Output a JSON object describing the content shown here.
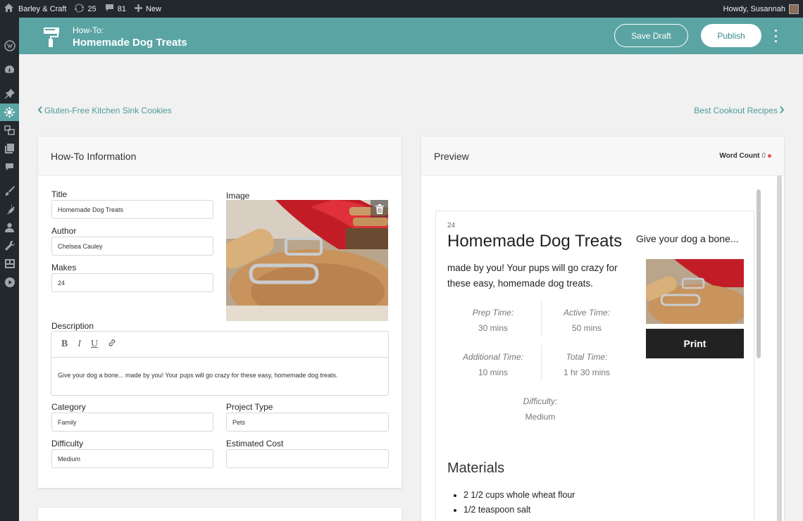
{
  "admin_bar": {
    "site_name": "Barley & Craft",
    "updates_count": "25",
    "comments_count": "81",
    "new_label": "New",
    "greeting": "Howdy, Susannah"
  },
  "header": {
    "kicker": "How-To:",
    "title": "Homemade Dog Treats",
    "save_draft_label": "Save Draft",
    "publish_label": "Publish"
  },
  "nav": {
    "prev_label": "Gluten-Free Kitchen Sink Cookies",
    "next_label": "Best Cookout Recipes"
  },
  "form": {
    "panel_title": "How-To Information",
    "title_label": "Title",
    "title_value": "Homemade Dog Treats",
    "author_label": "Author",
    "author_value": "Chelsea Cauley",
    "makes_label": "Makes",
    "makes_value": "24",
    "image_label": "Image",
    "description_label": "Description",
    "description_value": "Give your dog a bone... made by you! Your pups will go crazy for these easy, homemade dog treats.",
    "toolbar": {
      "bold": "B",
      "italic": "I",
      "underline": "U"
    },
    "category_label": "Category",
    "category_value": "Family",
    "project_type_label": "Project Type",
    "project_type_value": "Pets",
    "difficulty_label": "Difficulty",
    "difficulty_value": "Medium",
    "estimated_cost_label": "Estimated Cost",
    "estimated_cost_value": ""
  },
  "preview": {
    "panel_title": "Preview",
    "word_count_label": "Word Count",
    "word_count_value": "0",
    "makes": "24",
    "title": "Homemade Dog Treats",
    "description": "made by you! Your pups will go crazy for these easy, homemade dog treats.",
    "tagline": "Give your dog a bone...",
    "print_label": "Print",
    "prep_time_label": "Prep Time:",
    "prep_time_value": "30 mins",
    "active_time_label": "Active Time:",
    "active_time_value": "50 mins",
    "additional_time_label": "Additional Time:",
    "additional_time_value": "10 mins",
    "total_time_label": "Total Time:",
    "total_time_value": "1 hr 30 mins",
    "difficulty_label": "Difficulty:",
    "difficulty_value": "Medium",
    "materials_heading": "Materials",
    "materials": [
      "2 1/2 cups whole wheat flour",
      "1/2 teaspoon salt"
    ]
  },
  "colors": {
    "accent": "#5ba4a4",
    "admin_bar": "#23282d",
    "print_button": "#222222",
    "word_count_dot": "#e2574c"
  }
}
